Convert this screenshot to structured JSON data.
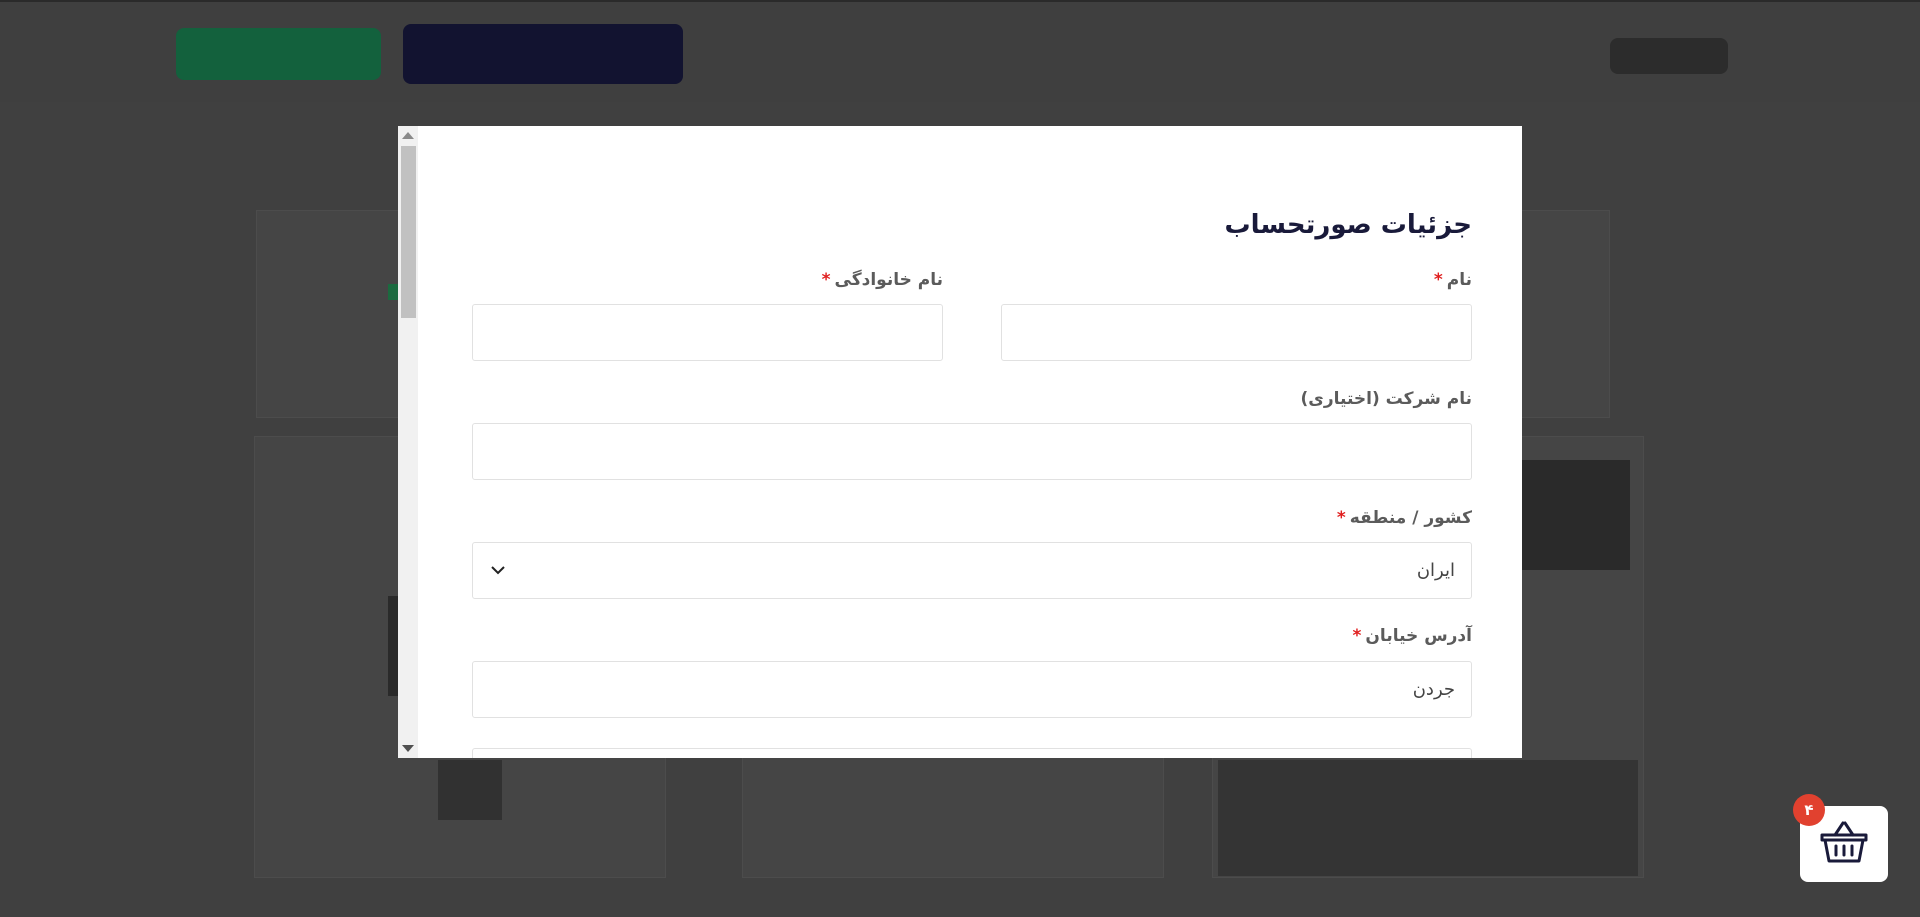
{
  "modal": {
    "title": "جزئیات صورتحساب",
    "required_mark": "*",
    "fields": {
      "first_name": {
        "label": "نام",
        "value": ""
      },
      "last_name": {
        "label": "نام خانوادگی",
        "value": ""
      },
      "company": {
        "label": "نام شرکت (اختیاری)",
        "value": ""
      },
      "country": {
        "label": "کشور / منطقه",
        "value": "ایران"
      },
      "street": {
        "label": "آدرس خیابان",
        "value": "جردن"
      }
    }
  },
  "cart": {
    "count": "۴",
    "icon": "basket-icon"
  },
  "colors": {
    "title": "#191a3a",
    "required": "#e01e1e",
    "badge": "#e1412f",
    "overlay": "#404040"
  }
}
